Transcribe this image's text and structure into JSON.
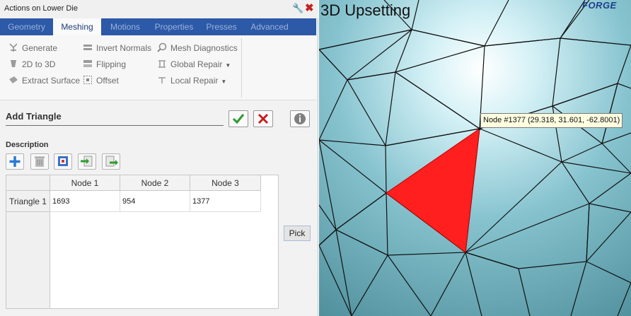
{
  "window": {
    "title": "Actions on Lower Die"
  },
  "tabs": [
    {
      "label": "Geometry"
    },
    {
      "label": "Meshing"
    },
    {
      "label": "Motions"
    },
    {
      "label": "Properties"
    },
    {
      "label": "Presses"
    },
    {
      "label": "Advanced"
    }
  ],
  "active_tab": "Meshing",
  "ribbon": {
    "generate": "Generate",
    "two_d_to_three_d": "2D to 3D",
    "extract_surface": "Extract Surface",
    "invert_normals": "Invert Normals",
    "flipping": "Flipping",
    "offset": "Offset",
    "mesh_diagnostics": "Mesh Diagnostics",
    "global_repair": "Global Repair",
    "local_repair": "Local Repair"
  },
  "section": {
    "title": "Add Triangle",
    "description_label": "Description"
  },
  "toolbar_icons": [
    "add-icon",
    "delete-icon",
    "select-icon",
    "import-icon",
    "export-icon"
  ],
  "table": {
    "columns": [
      "Node 1",
      "Node 2",
      "Node 3"
    ],
    "rows": [
      {
        "label": "Triangle 1",
        "values": [
          "1693",
          "954",
          "1377"
        ]
      }
    ]
  },
  "pick_button": "Pick",
  "viewport": {
    "title": "3D Upsetting",
    "logo": "FORGE",
    "node_tooltip": "Node #1377 (29.318, 31.601, -62.8001)",
    "highlight_color": "#ff1f1f",
    "mesh_color": "#87c7d2"
  }
}
